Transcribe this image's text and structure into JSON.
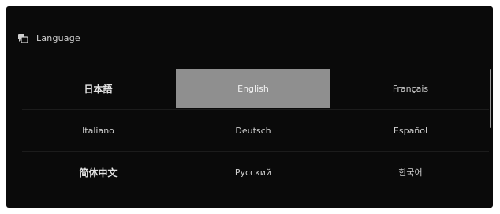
{
  "header": {
    "title": "Language",
    "icon": "language-icon"
  },
  "languages": [
    [
      "日本語",
      "English",
      "Français"
    ],
    [
      "Italiano",
      "Deutsch",
      "Español"
    ],
    [
      "简体中文",
      "Русский",
      "한국어"
    ]
  ],
  "selected": "English",
  "colors": {
    "background": "#0a0a0a",
    "selected": "#8f8f8f",
    "text": "#cfcfcf"
  }
}
